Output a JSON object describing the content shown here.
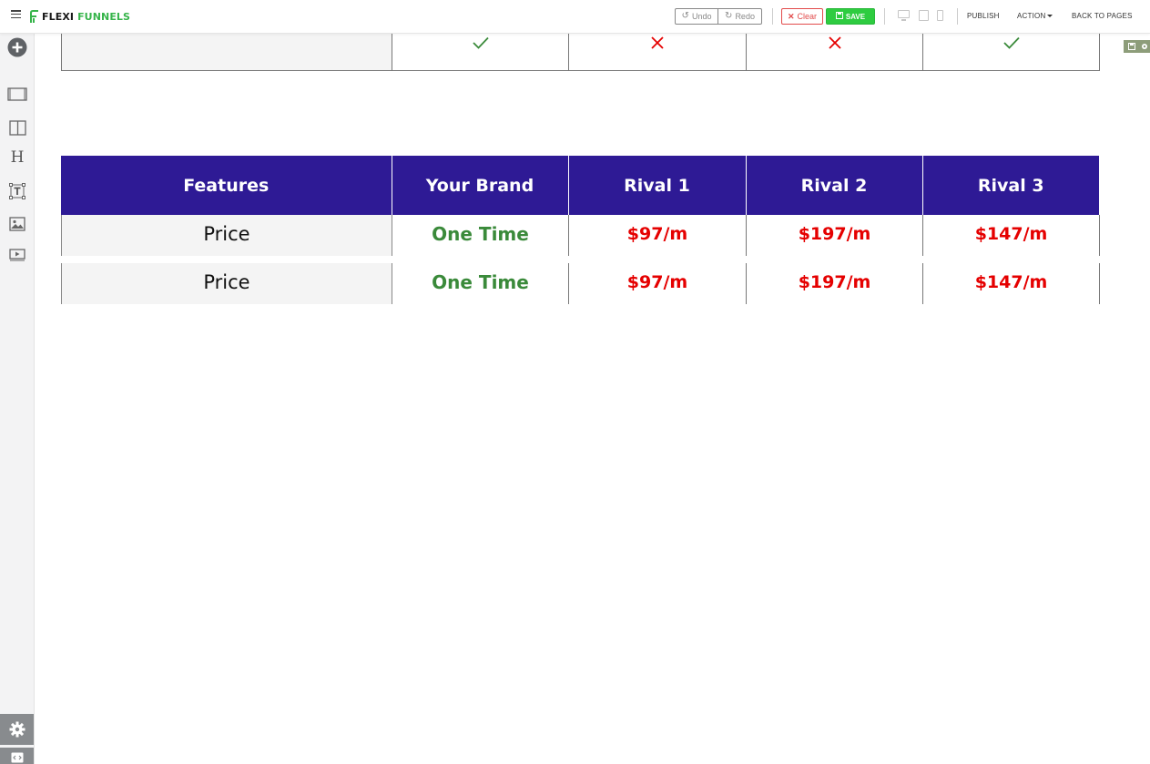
{
  "app": {
    "logo_word1": "FLEXI",
    "logo_word2": "FUNNELS",
    "brand_green": "#36b44a"
  },
  "toolbar": {
    "undo_label": "Undo",
    "redo_label": "Redo",
    "clear_label": "Clear",
    "save_label": "SAVE",
    "publish_label": "PUBLISH",
    "action_label": "ACTION",
    "back_label": "BACK TO PAGES",
    "icons": [
      "menu-icon",
      "undo-icon",
      "redo-icon",
      "close-icon",
      "save-icon",
      "desktop-icon",
      "tablet-icon",
      "phone-icon",
      "caret-down-icon"
    ]
  },
  "sidebar": {
    "heading_glyph": "H",
    "items": [
      "add-element",
      "section",
      "columns",
      "heading",
      "text",
      "image",
      "video"
    ],
    "bottom": [
      "settings",
      "code"
    ]
  },
  "table": {
    "header_bg": "#2e1a95",
    "check_color": "#3a8a3a",
    "cross_color": "#e50000",
    "top_row_marks": [
      "check",
      "cross",
      "cross",
      "check"
    ],
    "headers": [
      "Features",
      "Your Brand",
      "Rival 1",
      "Rival 2",
      "Rival 3"
    ],
    "rows": [
      {
        "feature": "Price",
        "brand": "One Time",
        "rival1": "$97/m",
        "rival2": "$197/m",
        "rival3": "$147/m"
      },
      {
        "feature": "Price",
        "brand": "One Time",
        "rival1": "$97/m",
        "rival2": "$197/m",
        "rival3": "$147/m"
      }
    ]
  }
}
